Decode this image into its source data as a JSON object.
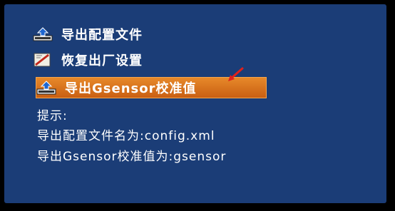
{
  "menu": {
    "items": [
      {
        "label": "导出配置文件",
        "icon": "export-icon"
      },
      {
        "label": "恢复出厂设置",
        "icon": "reset-icon"
      },
      {
        "label": "导出Gsensor校准值",
        "icon": "export-icon"
      }
    ],
    "selected_index": 2
  },
  "hints": {
    "title": "提示:",
    "line1": "导出配置文件名为:config.xml",
    "line2": "导出Gsensor校准值为:gsensor"
  },
  "colors": {
    "background": "#1b3d77",
    "highlight": "#d8741d",
    "annotation_arrow": "#e0201b"
  }
}
